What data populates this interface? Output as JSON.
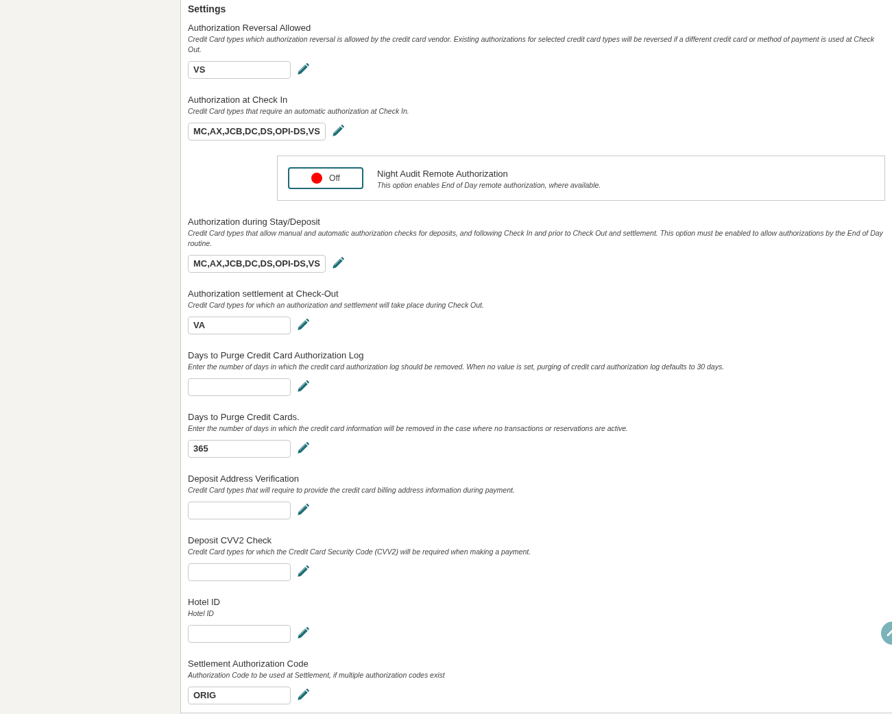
{
  "heading": "Settings",
  "settings": [
    {
      "kind": "field",
      "label": "Authorization Reversal Allowed",
      "description": "Credit Card types which authorization reversal is allowed by the credit card vendor. Existing authorizations for selected credit card types will be reversed if a different credit card or method of payment is used at Check Out.",
      "value": "VS"
    },
    {
      "kind": "field",
      "label": "Authorization at Check In",
      "description": "Credit Card types that require an automatic authorization at Check In.",
      "value": "MC,AX,JCB,DC,DS,OPI-DS,VS"
    },
    {
      "kind": "toggle",
      "on": false,
      "state_label": "Off",
      "label": "Night Audit Remote Authorization",
      "description": "This option enables End of Day remote authorization, where available."
    },
    {
      "kind": "field",
      "label": "Authorization during Stay/Deposit",
      "description": "Credit Card types that allow manual and automatic authorization checks for deposits, and following Check In and prior to Check Out and settlement. This option must be enabled to allow authorizations by the End of Day routine.",
      "value": "MC,AX,JCB,DC,DS,OPI-DS,VS"
    },
    {
      "kind": "field",
      "label": "Authorization settlement at Check-Out",
      "description": "Credit Card types for which an authorization and settlement will take place during Check Out.",
      "value": "VA"
    },
    {
      "kind": "field",
      "label": "Days to Purge Credit Card Authorization Log",
      "description": "Enter the number of days in which the credit card authorization log should be removed. When no value is set, purging of credit card authorization log defaults to 30 days."
    },
    {
      "kind": "field",
      "label": "Days to Purge Credit Cards.",
      "description": "Enter the number of days in which the credit card information will be removed in the case where no transactions or reservations are active.",
      "value": "365"
    },
    {
      "kind": "field",
      "label": "Deposit Address Verification",
      "description": "Credit Card types that will require to provide the credit card billing address information during payment."
    },
    {
      "kind": "field",
      "label": "Deposit CVV2 Check",
      "description": "Credit Card types for which the Credit Card Security Code (CVV2) will be required when making a payment."
    },
    {
      "kind": "field",
      "label": "Hotel ID",
      "description": "Hotel ID"
    },
    {
      "kind": "field",
      "label": "Settlement Authorization Code",
      "description": "Authorization Code to be used at Settlement, if multiple authorization codes exist",
      "value": "ORIG"
    }
  ]
}
